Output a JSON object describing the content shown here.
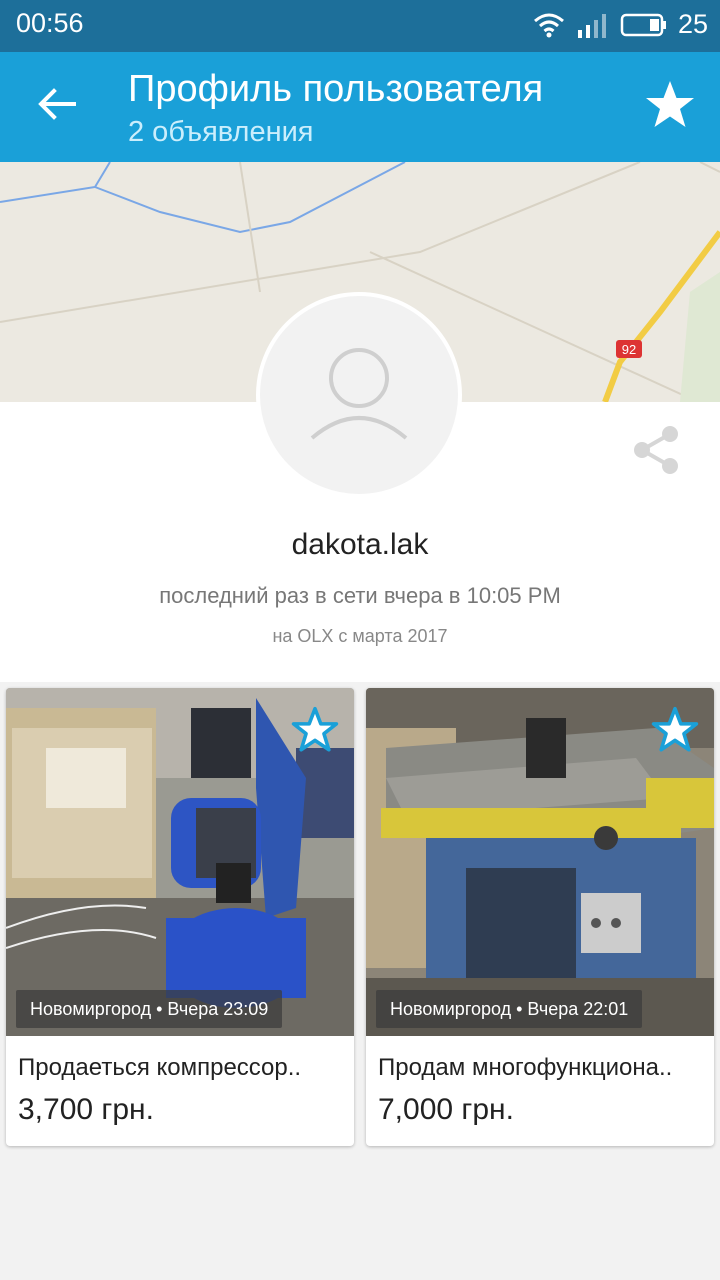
{
  "status_bar": {
    "time": "00:56",
    "battery": "25",
    "icons": [
      "wifi-icon",
      "signal-icon",
      "battery-icon"
    ]
  },
  "app_bar": {
    "title": "Профиль пользователя",
    "subtitle": "2 объявления",
    "back_icon": "arrow-left-icon",
    "favorite_icon": "star-icon",
    "color": "#1aa0d8"
  },
  "map": {
    "road_label": "92"
  },
  "profile": {
    "username": "dakota.lak",
    "last_seen": "последний раз в сети вчера в 10:05 PM",
    "member_since": "на OLX с марта 2017",
    "share_icon": "share-icon",
    "avatar_icon": "user-placeholder-icon"
  },
  "listings": [
    {
      "location_time": "Новомиргород • Вчера 23:09",
      "title": "Продаеться компрессор..",
      "price": "3,700 грн."
    },
    {
      "location_time": "Новомиргород • Вчера 22:01",
      "title": "Продам многофункциона..",
      "price": "7,000 грн."
    }
  ]
}
